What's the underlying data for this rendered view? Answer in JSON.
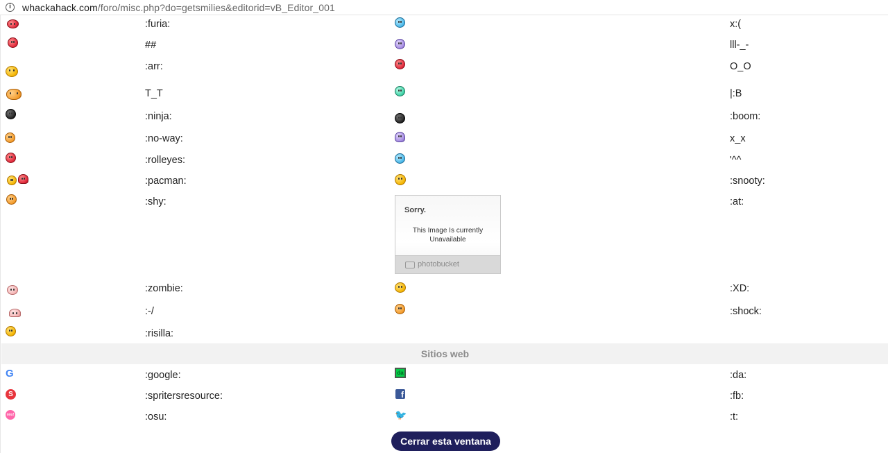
{
  "browser": {
    "url_host": "whackahack.com",
    "url_path": "/foro/misc.php?do=getsmilies&editorid=vB_Editor_001"
  },
  "smilies": [
    {
      "code1": ":furia:",
      "code2": "x:(",
      "icon1": "angry-red-smiley-icon",
      "icon2": "crying-blue-smiley-icon"
    },
    {
      "code1": "##",
      "code2": "lll-_-",
      "icon1": "pink-confused-smiley-icon",
      "icon2": "purple-gloomy-smiley-icon"
    },
    {
      "code1": ":arr:",
      "code2": "O_O",
      "icon1": "pirate-smiley-icon",
      "icon2": "surprised-red-smiley-icon"
    },
    {
      "code1": "T_T",
      "code2": "|:B",
      "icon1": "crying-tears-smiley-icon",
      "icon2": "green-sick-smiley-icon"
    },
    {
      "code1": ":ninja:",
      "code2": ":boom:",
      "icon1": "ninja-smiley-icon",
      "icon2": "bomb-icon"
    },
    {
      "code1": ":no-way:",
      "code2": "x_x",
      "icon1": "no-way-smiley-icon",
      "icon2": "purple-ghost-icon"
    },
    {
      "code1": ":rolleyes:",
      "code2": "'^^",
      "icon1": "rolleyes-smiley-icon",
      "icon2": "blue-smiley-icon"
    },
    {
      "code1": ":pacman:",
      "code2": ":snooty:",
      "icon1": "pacman-icon",
      "icon2": "snooty-smiley-icon"
    },
    {
      "code1": ":shy:",
      "code2": ":at:",
      "icon1": "shy-smiley-icon",
      "icon2": "image-unavailable-placeholder"
    },
    {
      "code1": ":zombie:",
      "code2": ":XD:",
      "icon1": "zombie-smiley-icon",
      "icon2": "xd-smiley-icon"
    },
    {
      "code1": ":-/",
      "code2": ":shock:",
      "icon1": "pink-skeptical-smiley-icon",
      "icon2": "shock-smiley-icon"
    },
    {
      "code1": ":risilla:",
      "code2": "",
      "icon1": "giggle-smiley-icon",
      "icon2": ""
    }
  ],
  "placeholder": {
    "sorry": "Sorry.",
    "line1": "This Image Is currently",
    "line2": "Unavailable",
    "brand": "photobucket"
  },
  "section": {
    "title": "Sitios web"
  },
  "websites": [
    {
      "code1": ":google:",
      "code2": ":da:",
      "icon1": "google-icon",
      "icon2": "deviantart-icon"
    },
    {
      "code1": ":spritersresource:",
      "code2": ":fb:",
      "icon1": "spriters-resource-icon",
      "icon2": "facebook-icon"
    },
    {
      "code1": ":osu:",
      "code2": ":t:",
      "icon1": "osu-icon",
      "icon2": "twitter-icon"
    }
  ],
  "icon_text": {
    "google": "G",
    "spriters": "S",
    "osu": "osu!",
    "facebook": "f",
    "twitter": "🐦",
    "deviantart": "da"
  },
  "footer": {
    "close_label": "Cerrar esta ventana"
  },
  "colors": {
    "button_bg": "#1f1f5c",
    "section_bg": "#f2f2f2",
    "section_text": "#8b8b8b"
  }
}
